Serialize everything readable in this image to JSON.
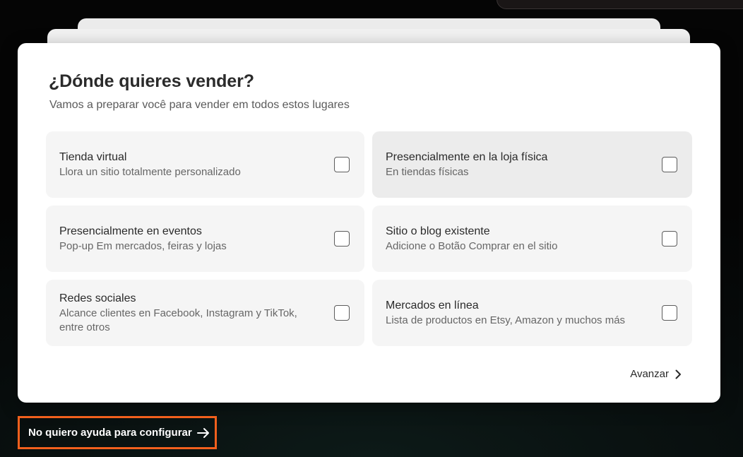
{
  "modal": {
    "title": "¿Dónde quieres vender?",
    "subtitle": "Vamos a preparar você para vender em todos estos lugares",
    "options": [
      {
        "title": "Tienda virtual",
        "description": "Llora un sitio totalmente personalizado",
        "checked": false
      },
      {
        "title": "Presencialmente en la loja física",
        "description": "En tiendas físicas",
        "checked": false
      },
      {
        "title": "Presencialmente en eventos",
        "description": "Pop-up Em mercados, feiras y lojas",
        "checked": false
      },
      {
        "title": "Sitio o blog existente",
        "description": "Adicione o Botão Comprar en el sitio",
        "checked": false
      },
      {
        "title": "Redes sociales",
        "description": "Alcance clientes en Facebook, Instagram y TikTok, entre otros",
        "checked": false
      },
      {
        "title": "Mercados en línea",
        "description": "Lista de productos en Etsy, Amazon y muchos más",
        "checked": false
      }
    ],
    "next_label": "Avanzar",
    "next_icon": "chevron-right-icon"
  },
  "skip": {
    "label": "No quiero ayuda para configurar",
    "icon": "arrow-right-icon",
    "highlight_color": "#f2601d"
  }
}
